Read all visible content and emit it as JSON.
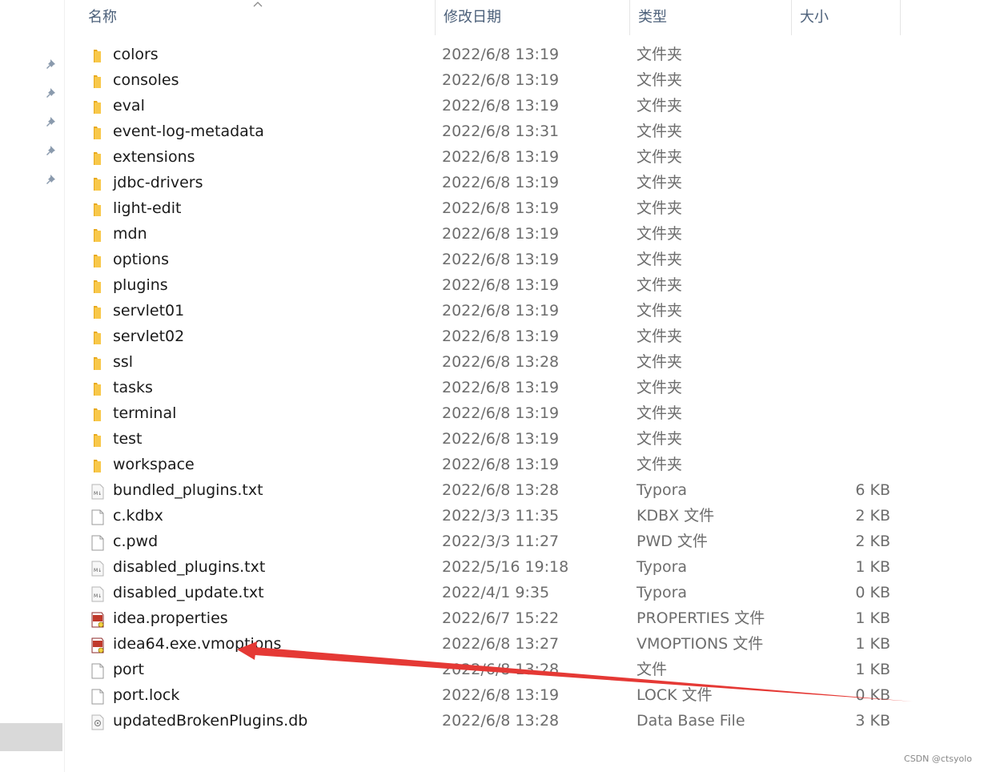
{
  "columns": {
    "name": "名称",
    "modified": "修改日期",
    "type": "类型",
    "size": "大小"
  },
  "files": [
    {
      "name": "colors",
      "modified": "2022/6/8 13:19",
      "type": "文件夹",
      "size": "",
      "icon": "folder-icon"
    },
    {
      "name": "consoles",
      "modified": "2022/6/8 13:19",
      "type": "文件夹",
      "size": "",
      "icon": "folder-icon"
    },
    {
      "name": "eval",
      "modified": "2022/6/8 13:19",
      "type": "文件夹",
      "size": "",
      "icon": "folder-icon"
    },
    {
      "name": "event-log-metadata",
      "modified": "2022/6/8 13:31",
      "type": "文件夹",
      "size": "",
      "icon": "folder-icon"
    },
    {
      "name": "extensions",
      "modified": "2022/6/8 13:19",
      "type": "文件夹",
      "size": "",
      "icon": "folder-icon"
    },
    {
      "name": "jdbc-drivers",
      "modified": "2022/6/8 13:19",
      "type": "文件夹",
      "size": "",
      "icon": "folder-icon"
    },
    {
      "name": "light-edit",
      "modified": "2022/6/8 13:19",
      "type": "文件夹",
      "size": "",
      "icon": "folder-icon"
    },
    {
      "name": "mdn",
      "modified": "2022/6/8 13:19",
      "type": "文件夹",
      "size": "",
      "icon": "folder-icon"
    },
    {
      "name": "options",
      "modified": "2022/6/8 13:19",
      "type": "文件夹",
      "size": "",
      "icon": "folder-icon"
    },
    {
      "name": "plugins",
      "modified": "2022/6/8 13:19",
      "type": "文件夹",
      "size": "",
      "icon": "folder-icon"
    },
    {
      "name": "servlet01",
      "modified": "2022/6/8 13:19",
      "type": "文件夹",
      "size": "",
      "icon": "folder-icon"
    },
    {
      "name": "servlet02",
      "modified": "2022/6/8 13:19",
      "type": "文件夹",
      "size": "",
      "icon": "folder-icon"
    },
    {
      "name": "ssl",
      "modified": "2022/6/8 13:28",
      "type": "文件夹",
      "size": "",
      "icon": "folder-icon"
    },
    {
      "name": "tasks",
      "modified": "2022/6/8 13:19",
      "type": "文件夹",
      "size": "",
      "icon": "folder-icon"
    },
    {
      "name": "terminal",
      "modified": "2022/6/8 13:19",
      "type": "文件夹",
      "size": "",
      "icon": "folder-icon"
    },
    {
      "name": "test",
      "modified": "2022/6/8 13:19",
      "type": "文件夹",
      "size": "",
      "icon": "folder-icon"
    },
    {
      "name": "workspace",
      "modified": "2022/6/8 13:19",
      "type": "文件夹",
      "size": "",
      "icon": "folder-icon"
    },
    {
      "name": "bundled_plugins.txt",
      "modified": "2022/6/8 13:28",
      "type": "Typora",
      "size": "6 KB",
      "icon": "markdown-file-icon"
    },
    {
      "name": "c.kdbx",
      "modified": "2022/3/3 11:35",
      "type": "KDBX 文件",
      "size": "2 KB",
      "icon": "blank-file-icon"
    },
    {
      "name": "c.pwd",
      "modified": "2022/3/3 11:27",
      "type": "PWD 文件",
      "size": "2 KB",
      "icon": "blank-file-icon"
    },
    {
      "name": "disabled_plugins.txt",
      "modified": "2022/5/16 19:18",
      "type": "Typora",
      "size": "1 KB",
      "icon": "markdown-file-icon"
    },
    {
      "name": "disabled_update.txt",
      "modified": "2022/4/1 9:35",
      "type": "Typora",
      "size": "0 KB",
      "icon": "markdown-file-icon"
    },
    {
      "name": "idea.properties",
      "modified": "2022/6/7 15:22",
      "type": "PROPERTIES 文件",
      "size": "1 KB",
      "icon": "config-file-icon"
    },
    {
      "name": "idea64.exe.vmoptions",
      "modified": "2022/6/8 13:27",
      "type": "VMOPTIONS 文件",
      "size": "1 KB",
      "icon": "config-file-icon"
    },
    {
      "name": "port",
      "modified": "2022/6/8 13:28",
      "type": "文件",
      "size": "1 KB",
      "icon": "blank-file-icon"
    },
    {
      "name": "port.lock",
      "modified": "2022/6/8 13:19",
      "type": "LOCK 文件",
      "size": "0 KB",
      "icon": "blank-file-icon"
    },
    {
      "name": "updatedBrokenPlugins.db",
      "modified": "2022/6/8 13:28",
      "type": "Data Base File",
      "size": "3 KB",
      "icon": "database-file-icon"
    }
  ],
  "quick_access_pins": [
    "pin-icon",
    "pin-icon",
    "pin-icon",
    "pin-icon",
    "pin-icon"
  ],
  "watermark": "CSDN @ctsyolo",
  "colors": {
    "annotation_arrow": "#e53935",
    "folder": "#f8c84a",
    "header_text": "#4c607a"
  }
}
